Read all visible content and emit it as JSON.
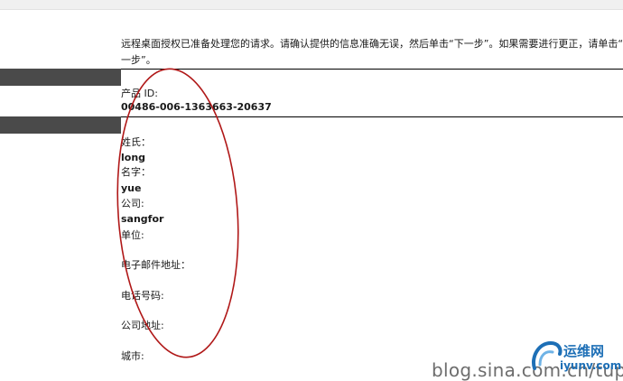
{
  "intro": {
    "line1": "远程桌面授权已准备处理您的请求。请确认提供的信息准确无误，然后单击“下一步”。如果需要进行更正，请单击“上",
    "line2": "一步”。"
  },
  "product": {
    "label": "产品 ID:",
    "value": "00486-006-1363663-20637"
  },
  "fields": {
    "surname_label": "姓氏：",
    "surname_value": "long",
    "givenname_label": "名字：",
    "givenname_value": "yue",
    "company_label": "公司:",
    "company_value": "sangfor",
    "department_label": "单位:",
    "email_label": "电子邮件地址：",
    "phone_label": "电话号码:",
    "address_label": "公司地址:",
    "city_label": "城市:"
  },
  "watermark": {
    "blog_text": "blog.sina.com.cn/tup",
    "logo_title": "运维网",
    "logo_url": "iyunv.com"
  },
  "colors": {
    "annotation": "#b01818",
    "sidebar": "#4a4a4a",
    "logo": "#1d6fb6"
  }
}
